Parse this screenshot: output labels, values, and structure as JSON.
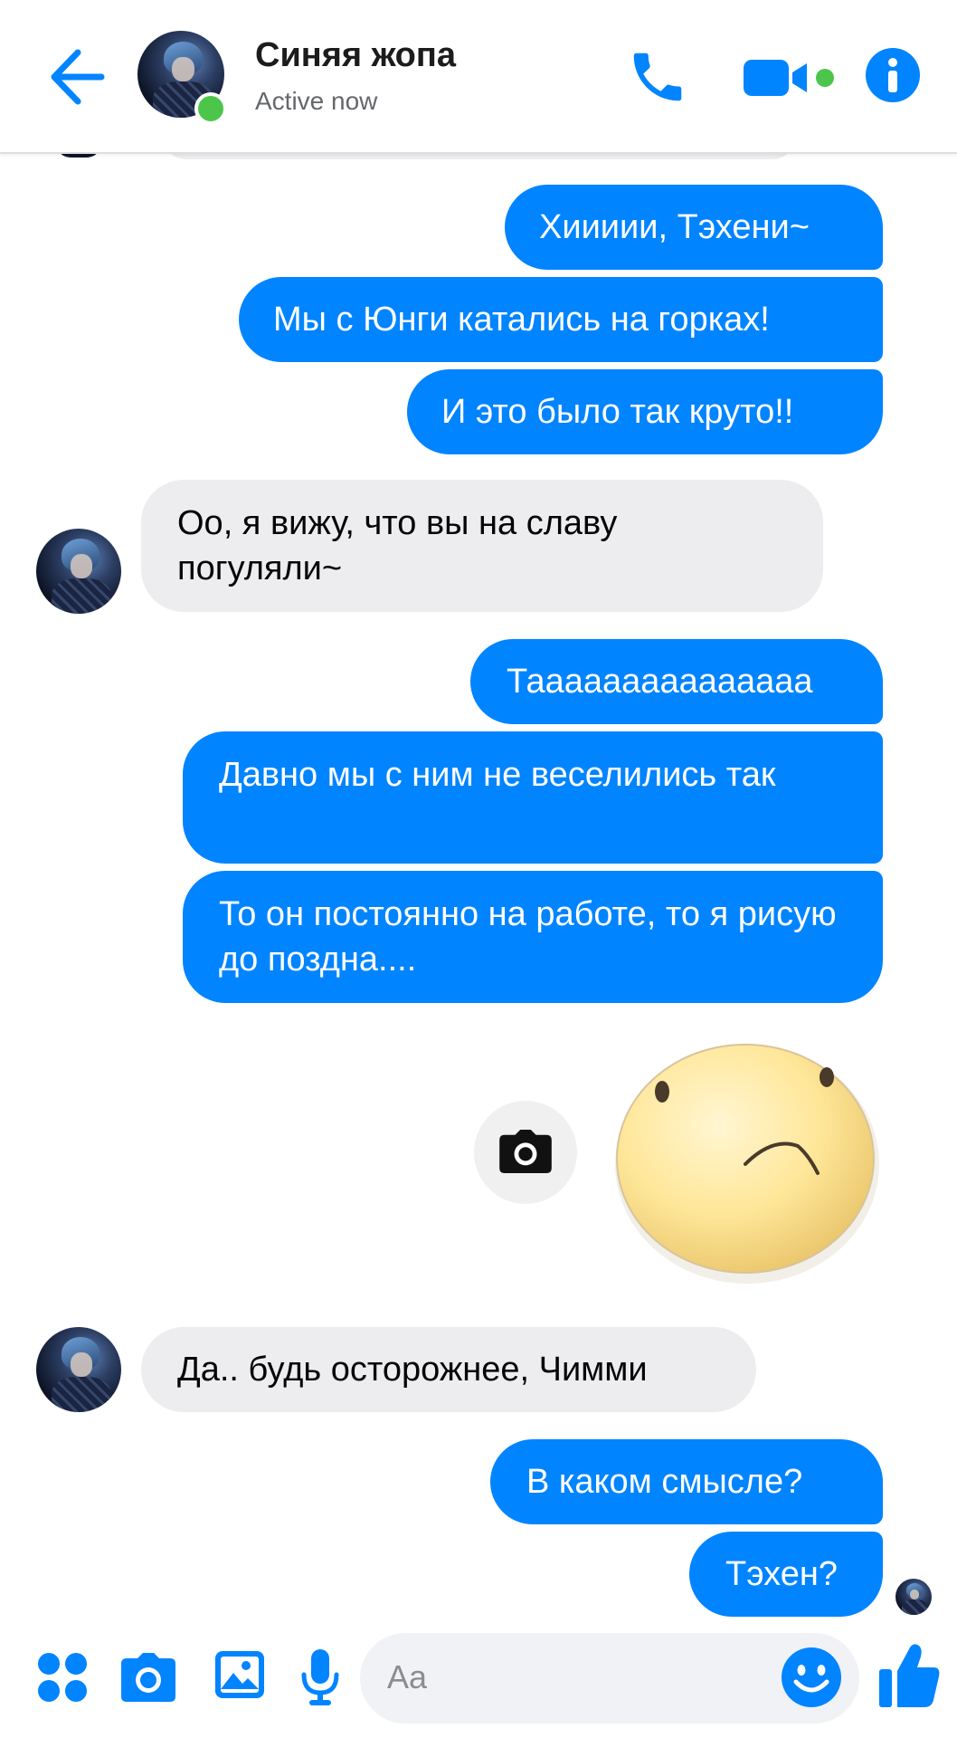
{
  "header": {
    "contact_name": "Синяя жопа",
    "status": "Active now",
    "avatar_icon": "contact-avatar",
    "online_color": "#4bc64b"
  },
  "icons": {
    "back": "arrow-left-icon",
    "call": "phone-icon",
    "video": "video-camera-icon",
    "info": "info-icon"
  },
  "messages": [
    {
      "from": "me",
      "text": "Хиииии, Тэхени~"
    },
    {
      "from": "me",
      "text": "Мы с Юнги катались на горках!"
    },
    {
      "from": "me",
      "text": "И это было так круто!!"
    },
    {
      "from": "contact",
      "text": "Оо, я вижу, что вы на славу погуляли~"
    },
    {
      "from": "me",
      "text": "Тааааааааааааааа"
    },
    {
      "from": "me",
      "text": "Давно мы с ним не веселились так"
    },
    {
      "from": "me",
      "text": "То он постоянно на работе, то я рисую до поздна...."
    },
    {
      "from": "me",
      "type": "sticker",
      "sticker": "sad-blob-sticker"
    },
    {
      "from": "contact",
      "text": "Да.. будь осторожнее, Чимми"
    },
    {
      "from": "me",
      "text": "В каком смысле?"
    },
    {
      "from": "me",
      "text": "Тэхен?"
    }
  ],
  "composer": {
    "placeholder": "Aa",
    "icons": [
      "apps-icon",
      "camera-icon",
      "gallery-icon",
      "microphone-icon",
      "emoji-icon",
      "thumbs-up-icon"
    ]
  },
  "colors": {
    "accent": "#0084ff",
    "incoming_bubble": "#ededf0"
  }
}
